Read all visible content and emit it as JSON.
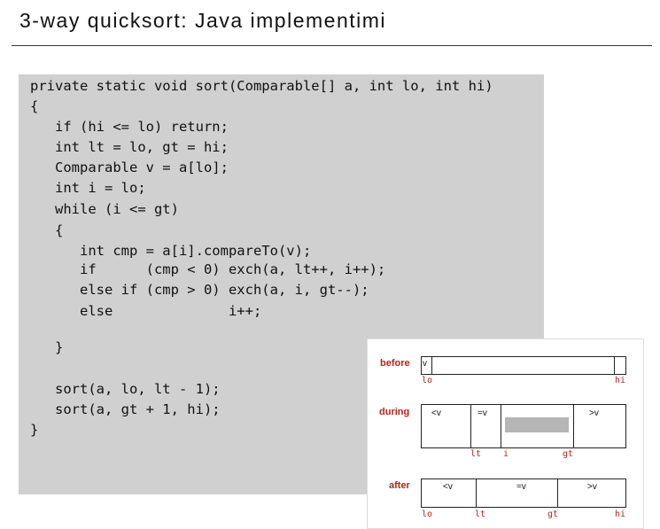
{
  "slide": {
    "title": "3-way quicksort: Java implementimi"
  },
  "code": {
    "lines": [
      "private static void sort(Comparable[] a, int lo, int hi)",
      "{",
      "   if (hi <= lo) return;",
      "   int lt = lo, gt = hi;",
      "   Comparable v = a[lo];",
      "   int i = lo;",
      "   while (i <= gt)",
      "   {",
      "      int cmp = a[i].compareTo(v);",
      "      if      (cmp < 0) exch(a, lt++, i++);",
      "      else if (cmp > 0) exch(a, i, gt--);",
      "      else              i++;",
      "   }",
      "   sort(a, lo, lt - 1);",
      "   sort(a, gt + 1, hi);",
      "}"
    ]
  },
  "diagram": {
    "before": {
      "label": "before",
      "v": "v",
      "idx_lo": "lo",
      "idx_hi": "hi"
    },
    "during": {
      "label": "during",
      "lt_region": "<v",
      "eq_region": "=v",
      "gt_region": ">v",
      "idx_lt": "lt",
      "idx_i": "i",
      "idx_gt": "gt"
    },
    "after": {
      "label": "after",
      "lt_region": "<v",
      "eq_region": "=v",
      "gt_region": ">v",
      "idx_lo": "lo",
      "idx_lt": "lt",
      "idx_gt": "gt",
      "idx_hi": "hi"
    },
    "colors": {
      "label_red": "#b3261e",
      "unknown_gray": "#b5b5b5"
    }
  }
}
